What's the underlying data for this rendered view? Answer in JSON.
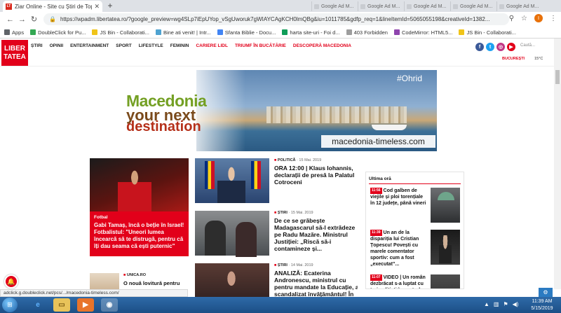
{
  "browser": {
    "active_tab": {
      "title": "Ziar Online - Site cu Știri de Top",
      "favicon": "LT"
    },
    "background_tabs": [
      "Google Ad M...",
      "Google Ad M...",
      "Google Ad M...",
      "Google Ad M...",
      "Google Ad M..."
    ],
    "url": "https://wpadm.libertatea.ro/?google_preview=wg4SLp7iEpUYop_vSgUworuk7gWIAYCAgKCH0lmQBg&iu=1011785&gdfp_req=1&lineItemId=5065055198&creativeId=1382...",
    "profile_initial": "I",
    "bookmarks": [
      {
        "label": "Apps",
        "color": "#5f6368"
      },
      {
        "label": "DoubleClick for Pu...",
        "color": "#34a853"
      },
      {
        "label": "JS Bin - Collaborati...",
        "color": "#f0c419"
      },
      {
        "label": "Bine ati venit! | Intr...",
        "color": "#4fa3d1"
      },
      {
        "label": "Sfanta Biblie - Docu...",
        "color": "#4285f4"
      },
      {
        "label": "harta site-uri - Foi d...",
        "color": "#0f9d58"
      },
      {
        "label": "403 Forbidden",
        "color": "#9e9e9e"
      },
      {
        "label": "CodeMirror: HTML5...",
        "color": "#8e44ad"
      },
      {
        "label": "JS Bin - Collaborati...",
        "color": "#f0c419"
      }
    ]
  },
  "site": {
    "logo_line1": "LIBER",
    "logo_line2": "TATEA",
    "nav": [
      {
        "label": "ȘTIRI",
        "red": false
      },
      {
        "label": "OPINII",
        "red": false
      },
      {
        "label": "ENTERTAINMENT",
        "red": false
      },
      {
        "label": "SPORT",
        "red": false
      },
      {
        "label": "LIFESTYLE",
        "red": false
      },
      {
        "label": "FEMININ",
        "red": false
      },
      {
        "label": "CARIERE LIDL",
        "red": true
      },
      {
        "label": "TRIUMF ÎN BUCĂTĂRIE",
        "red": true
      },
      {
        "label": "DESCOPERĂ MACEDONIA",
        "red": true
      }
    ],
    "social": [
      {
        "name": "facebook-icon",
        "glyph": "f",
        "color": "#3b5998"
      },
      {
        "name": "twitter-icon",
        "glyph": "t",
        "color": "#1da1f2"
      },
      {
        "name": "instagram-icon",
        "glyph": "◎",
        "color": "#c13584"
      },
      {
        "name": "youtube-icon",
        "glyph": "▶",
        "color": "#e2001a"
      }
    ],
    "search_placeholder": "Caută...",
    "city": "BUCUREȘTI",
    "temperature": "15°C"
  },
  "banner": {
    "line1": "Macedonia",
    "line2": "your next",
    "line3": "destination",
    "tag": "#Ohrid",
    "url": "macedonia-timeless.com"
  },
  "featured": {
    "category": "Fotbal",
    "title": "Gabi Tamaș, încă o beție în Israel! Fotbalistul: \"Uneori lumea încearcă să te distrugă, pentru că îți dau seama că ești puternic\""
  },
  "articles": [
    {
      "category": "POLITICĂ",
      "date": "15 Mai. 2019",
      "title": "ORA 12:00 | Klaus Iohannis, declarații de presă la Palatul Cotroceni"
    },
    {
      "category": "ȘTIRI",
      "date": "15 Mai. 2019",
      "title": "De ce se grăbește Madagascarul să-l extrădeze pe Radu Mazăre. Ministrul Justiției: „Riscă să-i contamineze și..."
    },
    {
      "category": "ȘTIRI",
      "date": "14 Mai. 2019",
      "title": "ANALIZĂ: Ecaterina Andronescu, ministrul cu pentru mandate la Educație, a scandalizat învățământul! În"
    }
  ],
  "ultima_ora": {
    "heading": "Ultima oră",
    "items": [
      {
        "time": "11:56",
        "title": "Cod galben de viejile și ploi torențiale în 12 județe, până vineri"
      },
      {
        "time": "11:39",
        "title": "Un an de la dispariția lui Cristian Țopescu! Povești cu marele comentator sportiv: cum a fost „executat”..."
      },
      {
        "time": "11:07",
        "title": "VIDEO | Un român dezbrăcat s-a luptat cu trei polițiști în centrul"
      }
    ]
  },
  "small_article": {
    "category": "UNICA.RO",
    "title": "O nouă lovitură pentru"
  },
  "status_url": "adclick.g.doubleclick.net/pcs/.../macedonia-timeless.com/",
  "taskbar": {
    "time": "11:39 AM",
    "date": "5/15/2019"
  }
}
